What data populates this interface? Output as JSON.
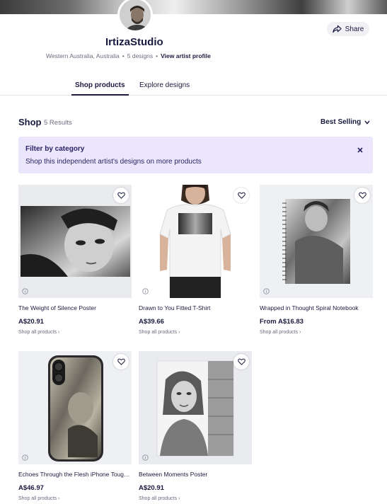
{
  "artist": {
    "name": "IrtizaStudio",
    "location": "Western Australia, Australia",
    "separator": "•",
    "designs": "5 designs",
    "view_profile": "View artist profile",
    "share_label": "Share"
  },
  "tabs": [
    {
      "label": "Shop products",
      "active": true
    },
    {
      "label": "Explore designs",
      "active": false
    }
  ],
  "shop": {
    "title": "Shop",
    "results": "5 Results",
    "sort_label": "Best Selling"
  },
  "filter": {
    "title": "Filter by category",
    "description": "Shop this independent artist's designs on more products"
  },
  "products": [
    {
      "title": "The Weight of Silence Poster",
      "price": "A$20.91",
      "link": "Shop all products ›"
    },
    {
      "title": "Drawn to You Fitted T-Shirt",
      "price": "A$39.66",
      "link": "Shop all products ›"
    },
    {
      "title": "Wrapped in Thought Spiral Notebook",
      "price": "From A$16.83",
      "link": "Shop all products ›"
    },
    {
      "title": "Echoes Through the Flesh iPhone Tough Case",
      "price": "A$46.97",
      "link": "Shop all products ›"
    },
    {
      "title": "Between Moments Poster",
      "price": "A$20.91",
      "link": "Shop all products ›"
    }
  ],
  "icons": {
    "share": "share-icon",
    "chevron": "chevron-down-icon",
    "close": "close-icon",
    "heart": "heart-icon",
    "info": "info-icon"
  },
  "colors": {
    "accent": "#1a1a3e",
    "filter_bg": "#ebe6fb",
    "muted": "#6b6b80"
  }
}
